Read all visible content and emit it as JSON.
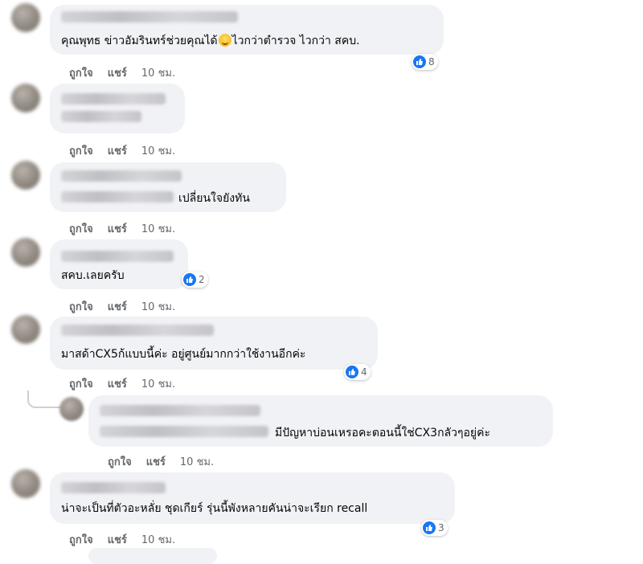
{
  "comments": [
    {
      "text": "คุณพุทธ ข่าวอัมรินทร์ช่วยคุณได้",
      "text_after": "ไวกว่าตำรวจ ไวกว่า สคบ.",
      "reactions": "8",
      "like": "ถูกใจ",
      "share": "แชร์",
      "time": "10 ชม."
    },
    {
      "text": "",
      "like": "ถูกใจ",
      "share": "แชร์",
      "time": "10 ชม."
    },
    {
      "text": "เปลี่ยนใจยังทัน",
      "like": "ถูกใจ",
      "share": "แชร์",
      "time": "10 ชม."
    },
    {
      "text": "สคบ.เลยครับ",
      "reactions": "2",
      "like": "ถูกใจ",
      "share": "แชร์",
      "time": "10 ชม."
    },
    {
      "text": "มาสด้าCX5ก้แบบนี้ค่ะ อยู่ศูนย์มากกว่าใช้งานอีกค่ะ",
      "reactions": "4",
      "like": "ถูกใจ",
      "share": "แชร์",
      "time": "10 ชม."
    },
    {
      "text": "มีปัญหาบ่อนเหรอคะตอนนี้ใช่CX3กลัวๆอยู่ค่ะ",
      "like": "ถูกใจ",
      "share": "แชร์",
      "time": "10 ชม."
    },
    {
      "text": "น่าจะเป็นที่ตัวอะหลั่ย ชุดเกียร์ รุ่นนี้พังหลายคันน่าจะเรียก recall",
      "reactions": "3",
      "like": "ถูกใจ",
      "share": "แชร์",
      "time": "10 ชม."
    }
  ],
  "colors": {
    "bubble": "#f0f2f5",
    "like_blue": "#1877f2",
    "meta_text": "#65676b"
  },
  "icons": {
    "reaction": "like-icon",
    "emoji": "smiling-face-emoji"
  }
}
